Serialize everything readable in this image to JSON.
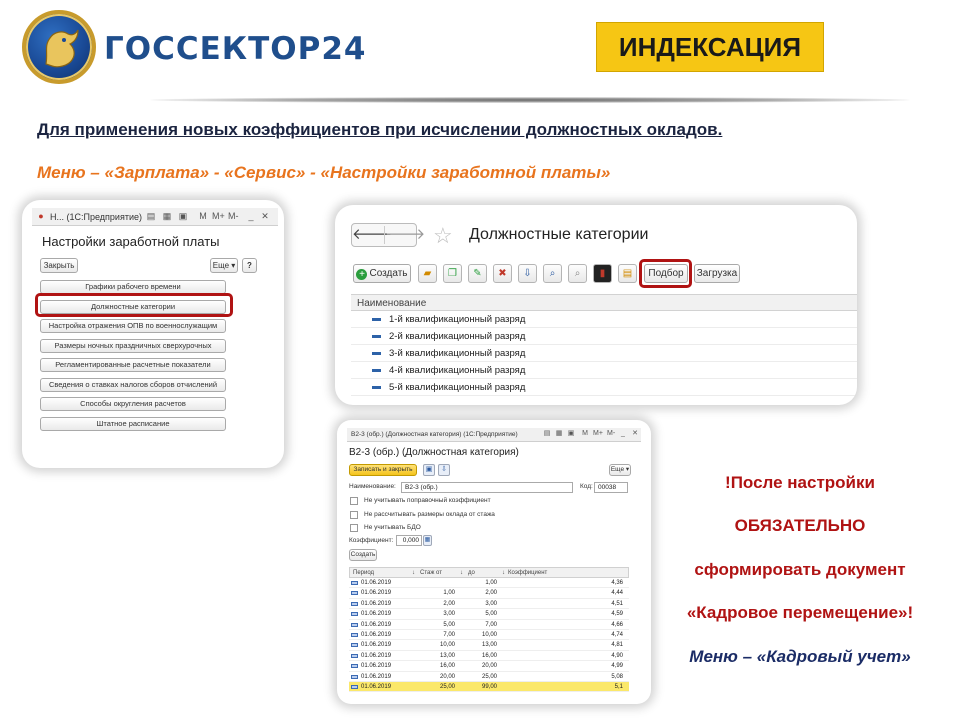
{
  "header": {
    "logo_text": "ГОССЕКТОР24",
    "title": "ИНДЕКСАЦИЯ"
  },
  "intro": {
    "purpose": "Для применения новых коэффициентов при исчислении должностных окладов.",
    "menu_path": "Меню – «Зарплата» - «Сервис» - «Настройки заработной платы»"
  },
  "settings_window": {
    "titlebar": "Н... (1С:Предприятие)",
    "titlebar_icons": [
      "M",
      "M+",
      "M-"
    ],
    "title": "Настройки заработной платы",
    "close_label": "Закрыть",
    "more_label": "Еще ▾",
    "help_label": "?",
    "items": [
      "Графики рабочего времени",
      "Должностные категории",
      "Настройка отражения ОПВ по военнослужащим",
      "Размеры ночных праздничных сверхурочных",
      "Регламентированные расчетные показатели",
      "Сведения о ставках налогов сборов отчислений",
      "Способы округления расчетов",
      "Штатное расписание"
    ]
  },
  "categories_window": {
    "title": "Должностные категории",
    "create_label": "Создать",
    "pick_label": "Подбор",
    "load_label": "Загрузка",
    "column_header": "Наименование",
    "rows": [
      "1-й квалификационный разряд",
      "2-й квалификационный разряд",
      "3-й квалификационный разряд",
      "4-й квалификационный разряд",
      "5-й квалификационный разряд"
    ]
  },
  "form_window": {
    "titlebar": "В2-3 (обр.) (Должностная категория) (1С:Предприятие)",
    "title": "В2-3 (обр.) (Должностная категория)",
    "save_close_label": "Записать и закрыть",
    "more_label": "Еще ▾",
    "name_label": "Наименование:",
    "name_value": "В2-3 (обр.)",
    "code_label": "Код:",
    "code_value": "00038",
    "checkboxes": [
      "Не учитывать поправочный коэффициент",
      "Не рассчитывать размеры оклада от стажа",
      "Не учитывать БДО"
    ],
    "coef_label": "Коэффициент:",
    "coef_value": "0,000",
    "create_label": "Создать",
    "columns": [
      "Период",
      "Стаж от",
      "до",
      "Коэффициент"
    ],
    "rows": [
      {
        "period": "01.06.2019",
        "from": "",
        "to": "1,00",
        "coef": "4,36"
      },
      {
        "period": "01.06.2019",
        "from": "1,00",
        "to": "2,00",
        "coef": "4,44"
      },
      {
        "period": "01.06.2019",
        "from": "2,00",
        "to": "3,00",
        "coef": "4,51"
      },
      {
        "period": "01.06.2019",
        "from": "3,00",
        "to": "5,00",
        "coef": "4,59"
      },
      {
        "period": "01.06.2019",
        "from": "5,00",
        "to": "7,00",
        "coef": "4,66"
      },
      {
        "period": "01.06.2019",
        "from": "7,00",
        "to": "10,00",
        "coef": "4,74"
      },
      {
        "period": "01.06.2019",
        "from": "10,00",
        "to": "13,00",
        "coef": "4,81"
      },
      {
        "period": "01.06.2019",
        "from": "13,00",
        "to": "16,00",
        "coef": "4,90"
      },
      {
        "period": "01.06.2019",
        "from": "16,00",
        "to": "20,00",
        "coef": "4,99"
      },
      {
        "period": "01.06.2019",
        "from": "20,00",
        "to": "25,00",
        "coef": "5,08"
      },
      {
        "period": "01.06.2019",
        "from": "25,00",
        "to": "99,00",
        "coef": "5,1"
      }
    ]
  },
  "note": {
    "line1": "!После настройки",
    "line2": "ОБЯЗАТЕЛЬНО",
    "line3": "сформировать документ",
    "line4": "«Кадровое перемещение»!",
    "line5": "Меню – «Кадровый учет»"
  }
}
